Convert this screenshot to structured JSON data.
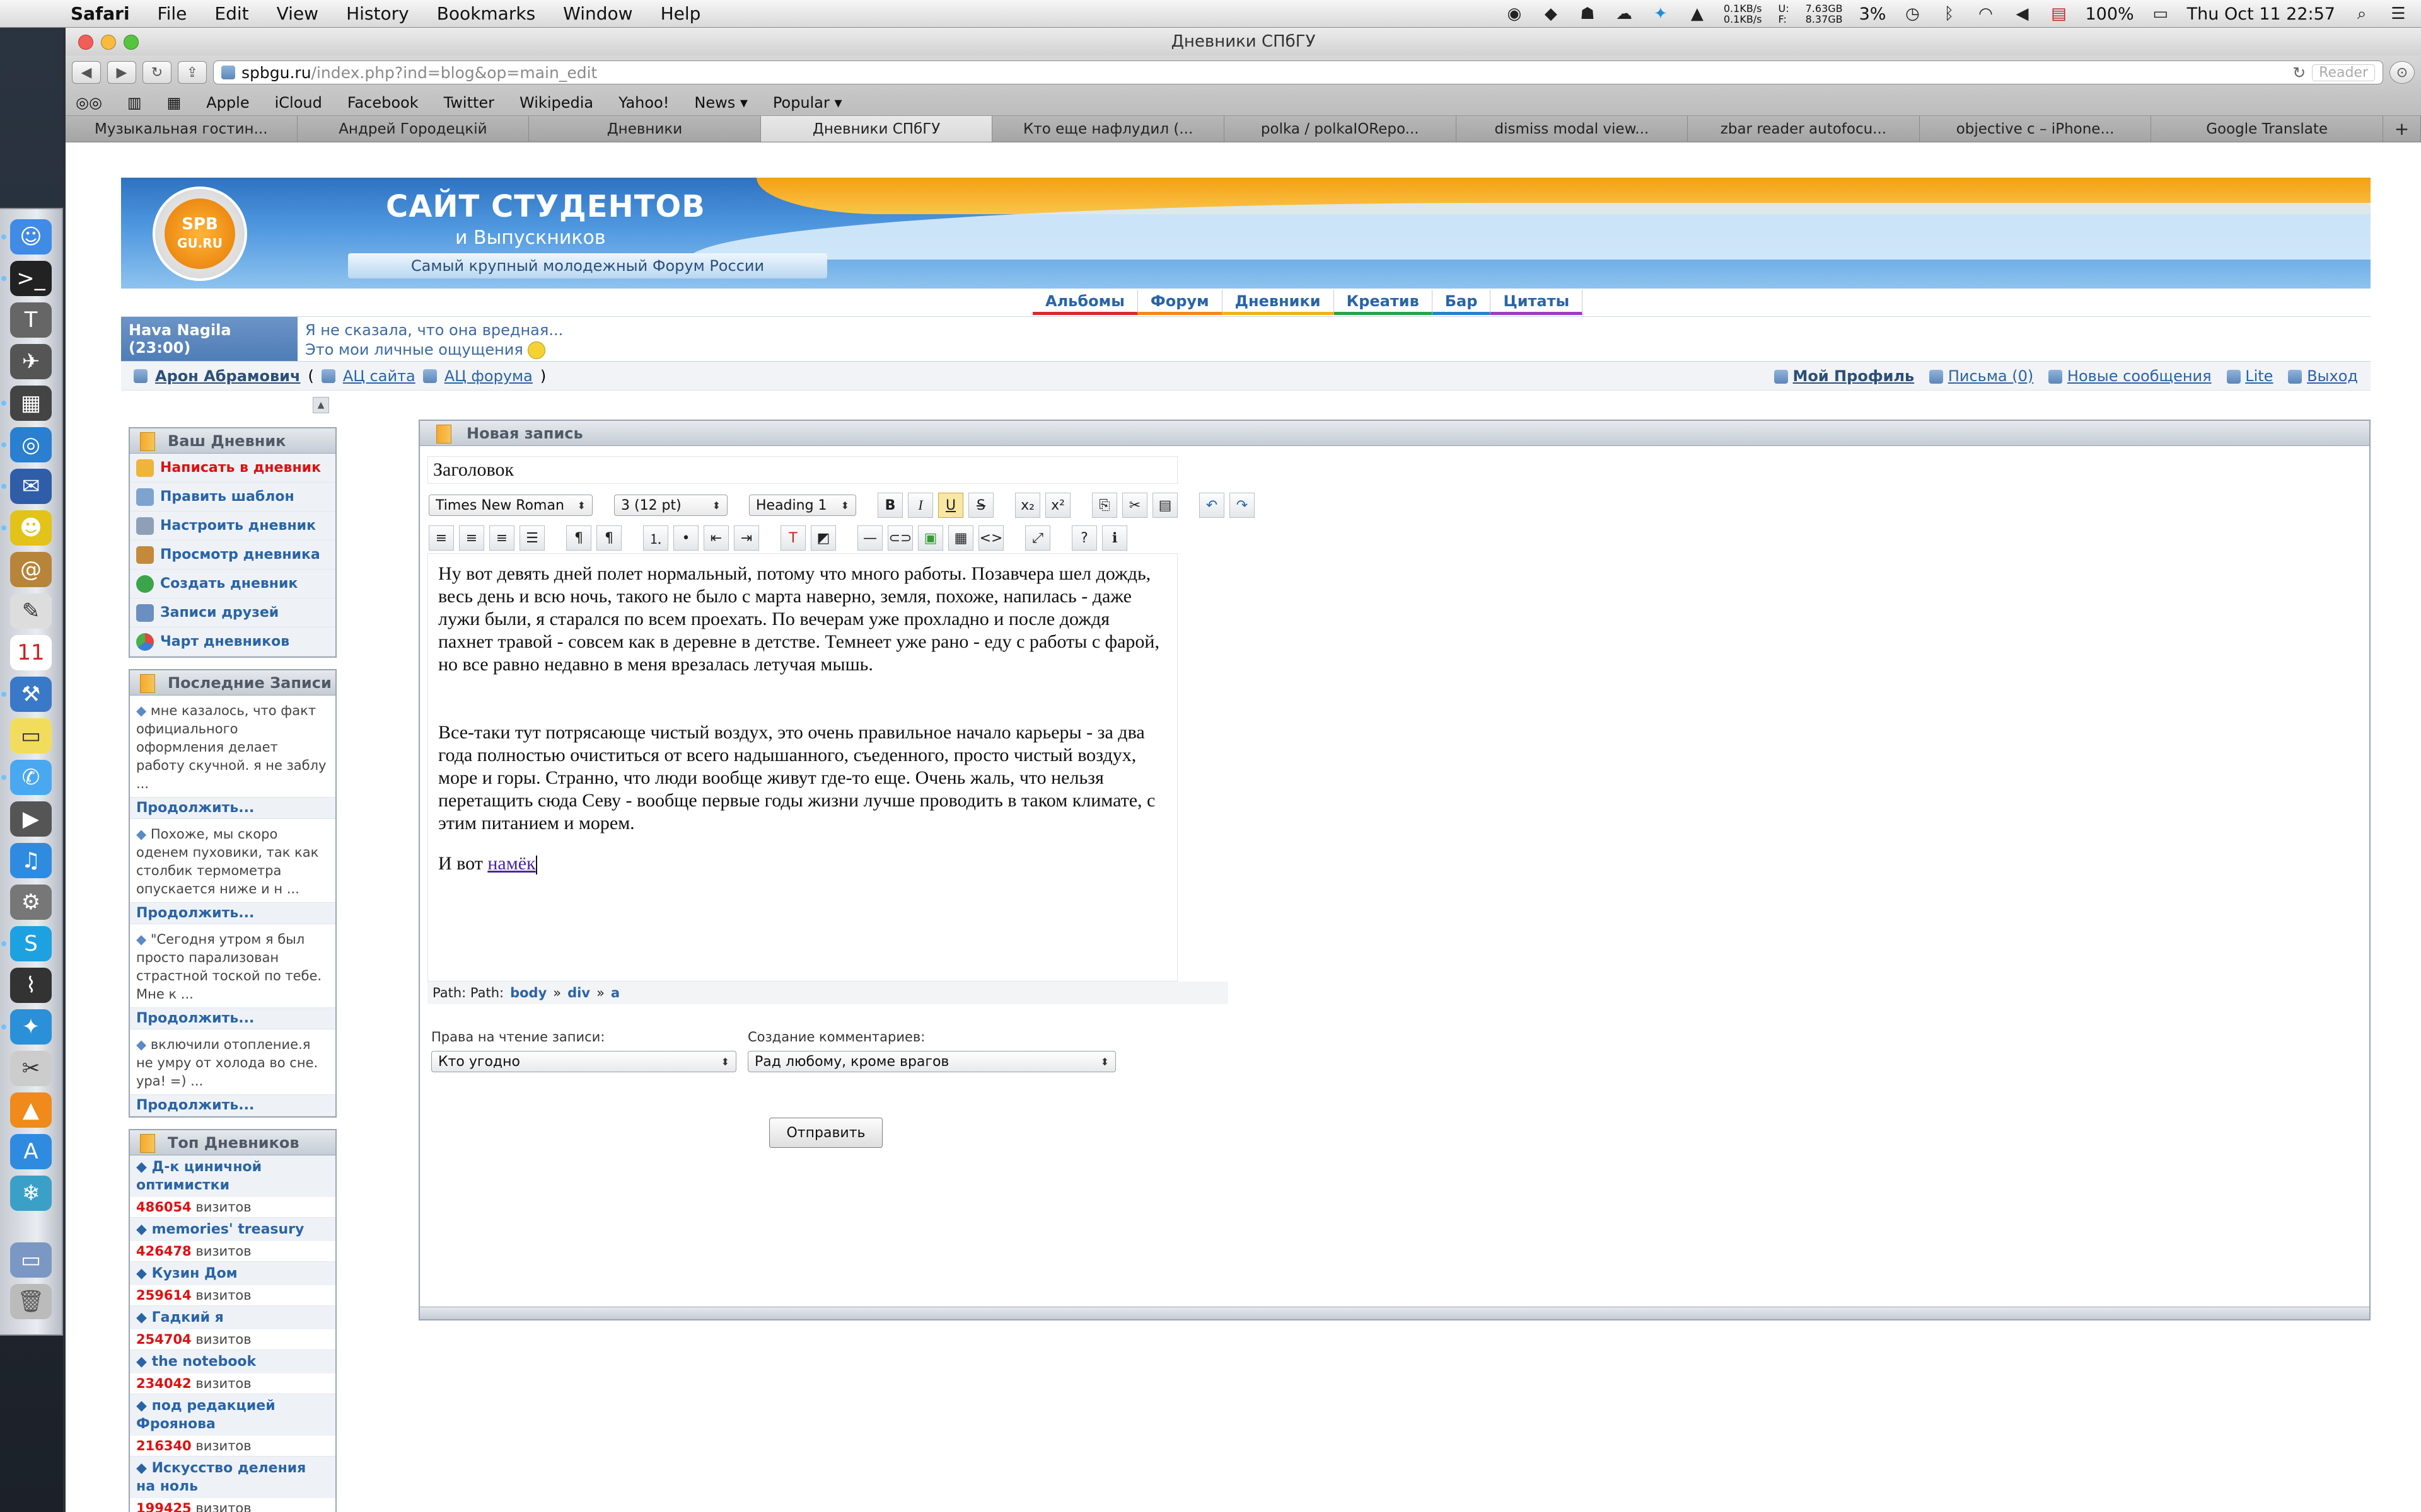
{
  "menubar": {
    "app": "Safari",
    "items": [
      "File",
      "Edit",
      "View",
      "History",
      "Bookmarks",
      "Window",
      "Help"
    ],
    "net_up": "0.1KB/s",
    "net_down": "0.1KB/s",
    "mem_u_label": "U:",
    "mem_f_label": "F:",
    "mem_u": "7.63GB",
    "mem_f": "8.37GB",
    "cpu": "3%",
    "battery": "100%",
    "clock": "Thu Oct 11  22:57"
  },
  "window": {
    "title": "Дневники СПбГУ",
    "url_host": "spbgu.ru",
    "url_path": "/index.php?ind=blog&op=main_edit",
    "reader": "Reader"
  },
  "bookmarks": [
    "Apple",
    "iCloud",
    "Facebook",
    "Twitter",
    "Wikipedia",
    "Yahoo!",
    "News ▾",
    "Popular ▾"
  ],
  "tabs": [
    {
      "label": "Музыкальная гостин...",
      "active": false
    },
    {
      "label": "Андрей Городецкій",
      "active": false
    },
    {
      "label": "Дневники",
      "active": false
    },
    {
      "label": "Дневники СПбГУ",
      "active": true
    },
    {
      "label": "Кто еще нафлудил (...",
      "active": false
    },
    {
      "label": "polka / polkaIORepo...",
      "active": false
    },
    {
      "label": "dismiss modal view...",
      "active": false
    },
    {
      "label": "zbar reader autofocu...",
      "active": false
    },
    {
      "label": "objective c – iPhone...",
      "active": false
    },
    {
      "label": "Google Translate",
      "active": false
    }
  ],
  "banner": {
    "logo_top": "SPB",
    "logo_bottom": "GU.RU",
    "title": "САЙТ СТУДЕНТОВ",
    "subtitle": "и Выпускников",
    "ribbon": "Самый крупный молодежный Форум России"
  },
  "nav": [
    {
      "label": "Альбомы",
      "color": "#d62b2b"
    },
    {
      "label": "Форум",
      "color": "#f08a1a"
    },
    {
      "label": "Дневники",
      "color": "#f2b21a"
    },
    {
      "label": "Креатив",
      "color": "#2aa24a"
    },
    {
      "label": "Бар",
      "color": "#2a7fd0"
    },
    {
      "label": "Цитаты",
      "color": "#a23ac4"
    }
  ],
  "status": {
    "who": "Hava Nagila (23:00)",
    "line1": "Я не сказала, что она вредная...",
    "line2": "Это мои личные ощущения"
  },
  "userbar": {
    "user": "Арон Абрамович",
    "open_paren": "(",
    "close_paren": ")",
    "ac_site": "АЦ сайта",
    "ac_forum": "АЦ форума",
    "profile": "Мой Профиль",
    "letters": "Письма (0)",
    "new_msgs": "Новые сообщения",
    "lite": "Lite",
    "logout": "Выход"
  },
  "sidebar": {
    "diary_title": "Ваш Дневник",
    "diary_items": [
      "Написать в дневник",
      "Править шаблон",
      "Настроить дневник",
      "Просмотр дневника",
      "Создать дневник",
      "Записи друзей",
      "Чарт дневников"
    ],
    "recent_title": "Последние Записи",
    "recent": [
      "мне казалось, что факт официального оформления делает работу скучной. я не заблу ...",
      "Похоже, мы скоро оденем пуховики, так как столбик термометра опускается ниже и н ...",
      "\"Сегодня утром я был просто парализован страстной тоской по тебе. Мне к ...",
      "включили отопление.я не умру от холода во сне. ура! =) ..."
    ],
    "continue": "Продолжить...",
    "top_title": "Топ Дневников",
    "visits_label": "визитов",
    "top": [
      {
        "name": "Д-к циничной оптимистки",
        "count": "486054"
      },
      {
        "name": "memories' treasury",
        "count": "426478"
      },
      {
        "name": "Кузин Дом",
        "count": "259614"
      },
      {
        "name": "Гадкий я",
        "count": "254704"
      },
      {
        "name": "the notebook",
        "count": "234042"
      },
      {
        "name": "под редакцией Фроянова",
        "count": "216340"
      },
      {
        "name": "Искусство деления на ноль",
        "count": "199425"
      }
    ]
  },
  "main": {
    "title": "Новая запись",
    "post_title": "Заголовок",
    "font": "Times New Roman",
    "size": "3 (12 pt)",
    "format": "Heading 1",
    "para1": "Ну вот девять дней полет нормальный, потому что много работы. Позавчера шел дождь, весь день и всю ночь, такого не было с марта наверно, земля, похоже, напилась - даже лужи были, я старался по всем проехать.  По вечерам уже прохладно и после дождя пахнет травой - совсем как в деревне в детстве. Темнеет уже рано - еду с работы с фарой, но все равно недавно в меня врезалась летучая мышь.",
    "para2": "Все-таки тут потрясающе чистый воздух, это очень правильное начало карьеры - за два года полностью очиститься от всего надышанного, съеденного, просто чистый воздух, море и горы. Странно, что люди вообще живут где-то еще. Очень жаль, что нельзя перетащить сюда Севу - вообще первые годы жизни лучше проводить в таком климате, с этим питанием и морем.",
    "para3_text": "И вот ",
    "para3_link": "намёк",
    "path_label": "Path: Path:",
    "path": [
      "body",
      "div",
      "a"
    ],
    "path_sep": "»",
    "read_label": "Права на чтение записи:",
    "read_value": "Кто угодно",
    "comment_label": "Создание комментариев:",
    "comment_value": "Рад любому, кроме врагов",
    "submit": "Отправить"
  }
}
